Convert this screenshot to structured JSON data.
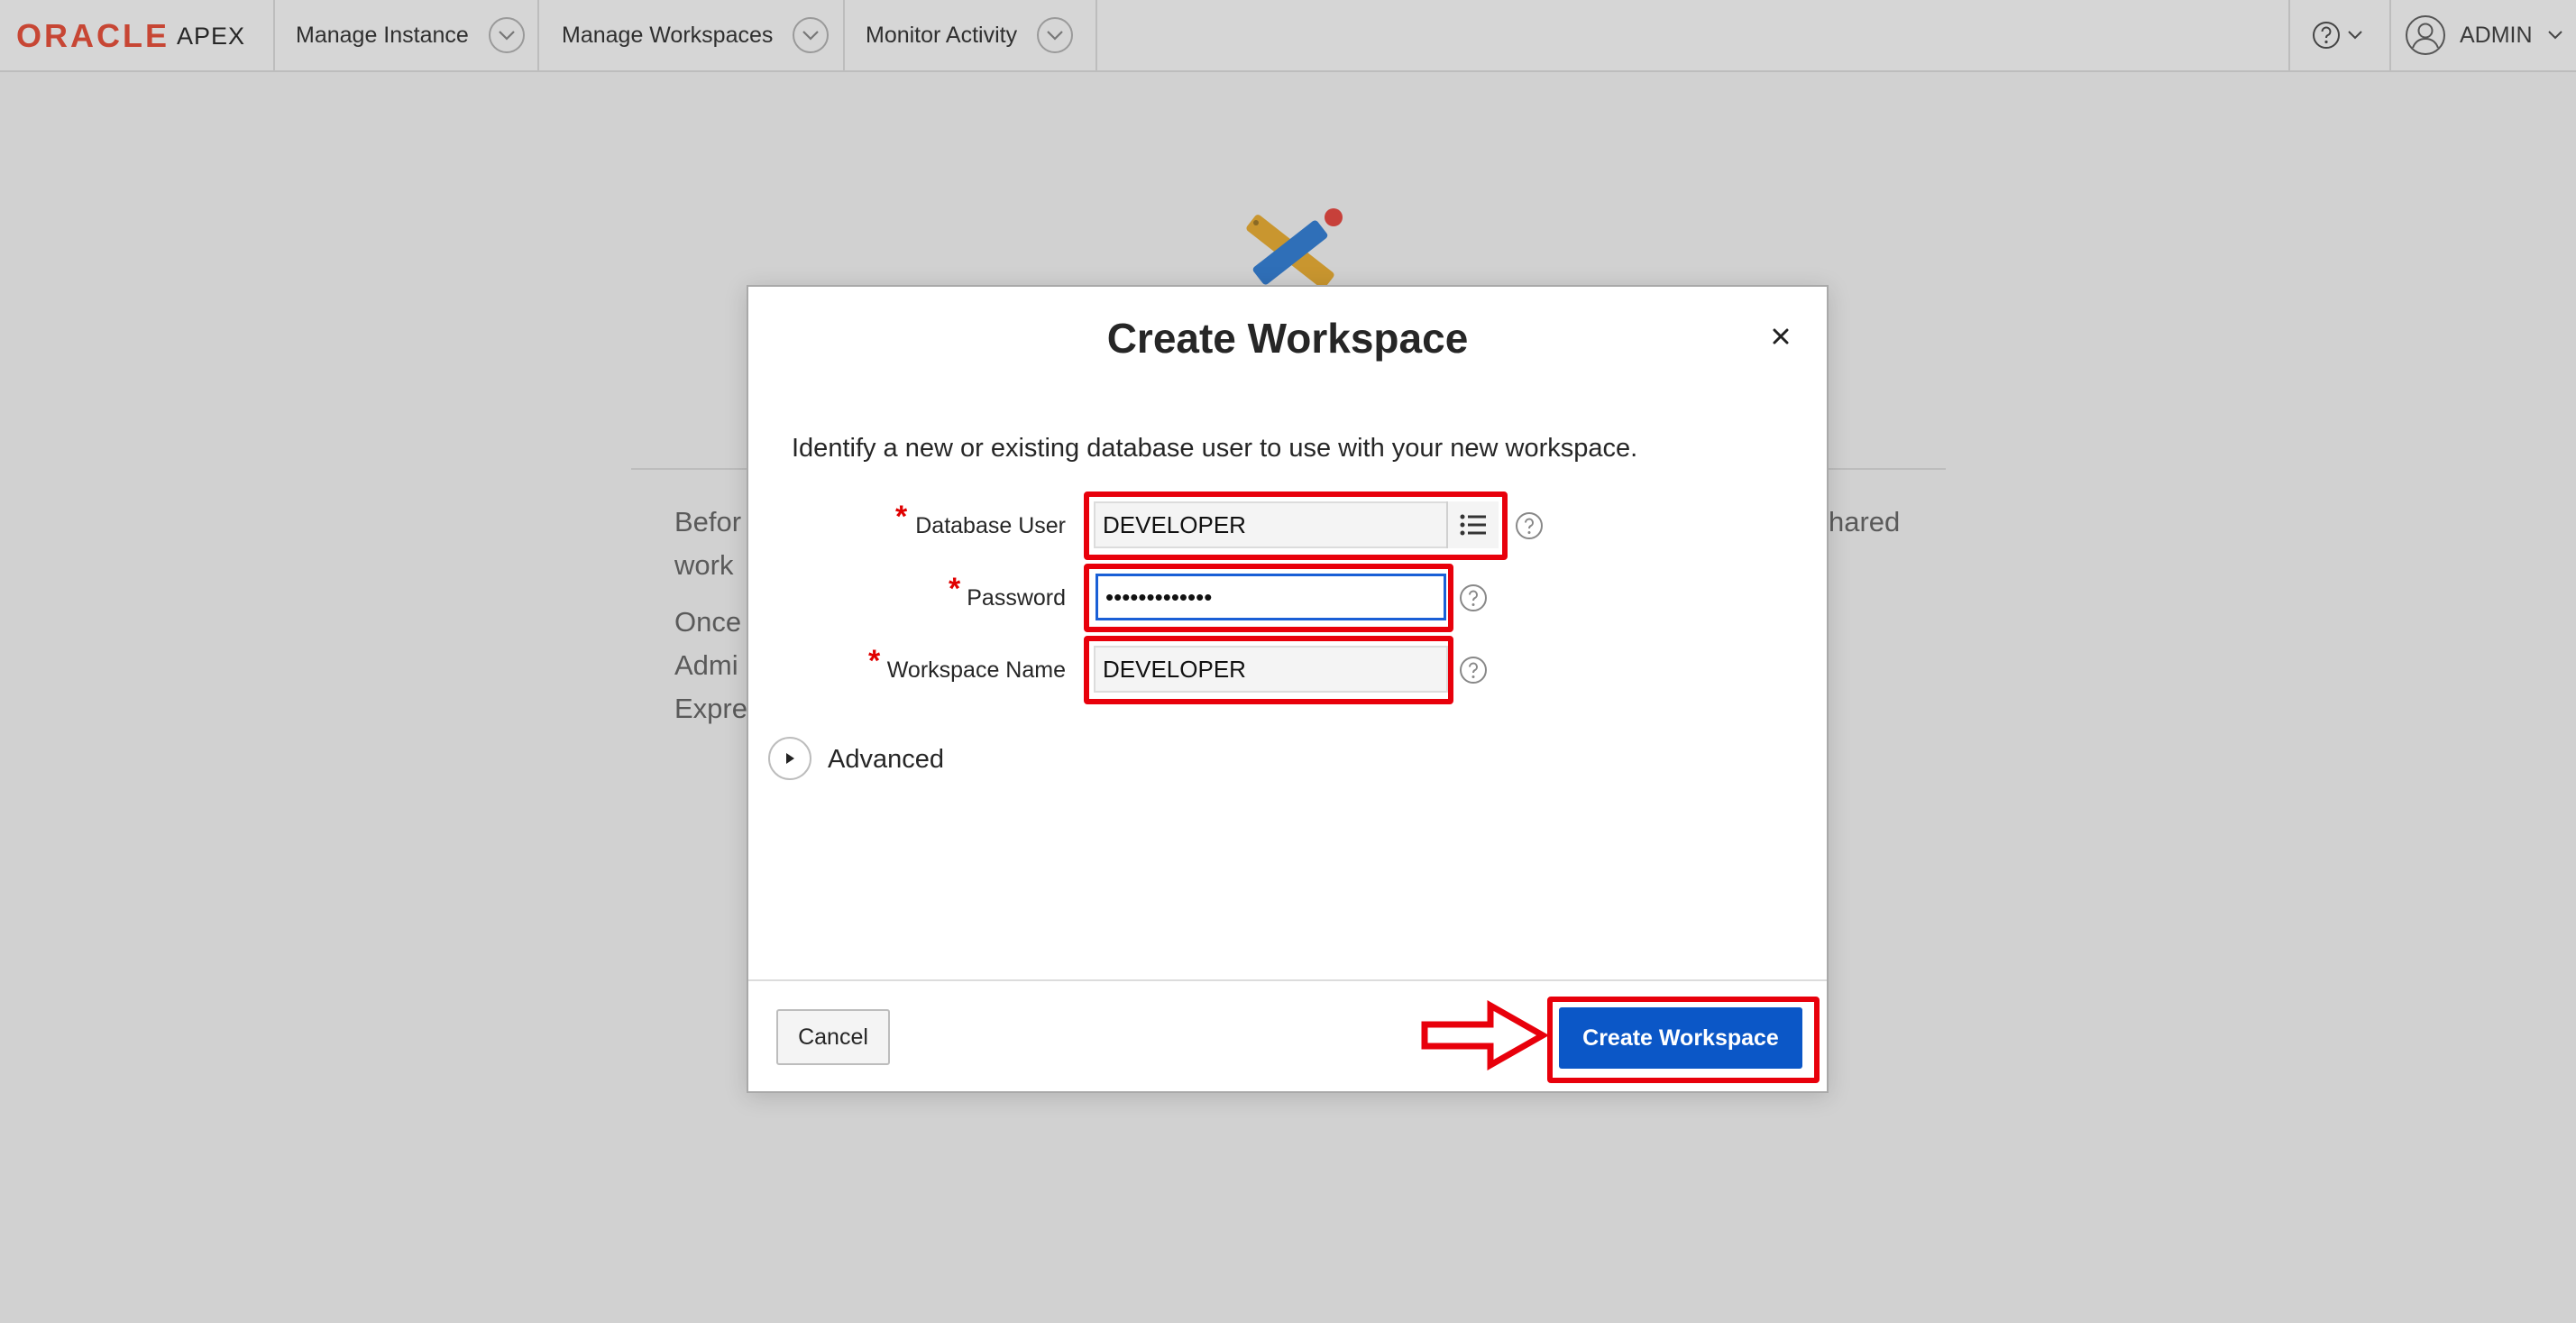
{
  "app": {
    "logo_brand": "ORACLE",
    "logo_product": "APEX"
  },
  "nav": {
    "items": [
      {
        "label": "Manage Instance"
      },
      {
        "label": "Manage Workspaces"
      },
      {
        "label": "Monitor Activity"
      }
    ],
    "help_icon": "help-circle-icon",
    "user_label": "ADMIN"
  },
  "background": {
    "lines": [
      "Befor",
      "work",
      "Once",
      "Admi",
      "Expre"
    ],
    "right_fragment": "hared"
  },
  "dialog": {
    "title": "Create Workspace",
    "intro": "Identify a new or existing database user to use with your new workspace.",
    "fields": {
      "database_user": {
        "label": "Database User",
        "value": "DEVELOPER",
        "required": "*"
      },
      "password": {
        "label": "Password",
        "value": "•••••••••••••",
        "required": "*"
      },
      "workspace_name": {
        "label": "Workspace Name",
        "value": "DEVELOPER",
        "required": "*"
      }
    },
    "advanced_label": "Advanced",
    "cancel_label": "Cancel",
    "create_label": "Create Workspace"
  },
  "colors": {
    "highlight": "#e8000b",
    "primary_button": "#0b57c7",
    "oracle_red": "#c74634"
  }
}
